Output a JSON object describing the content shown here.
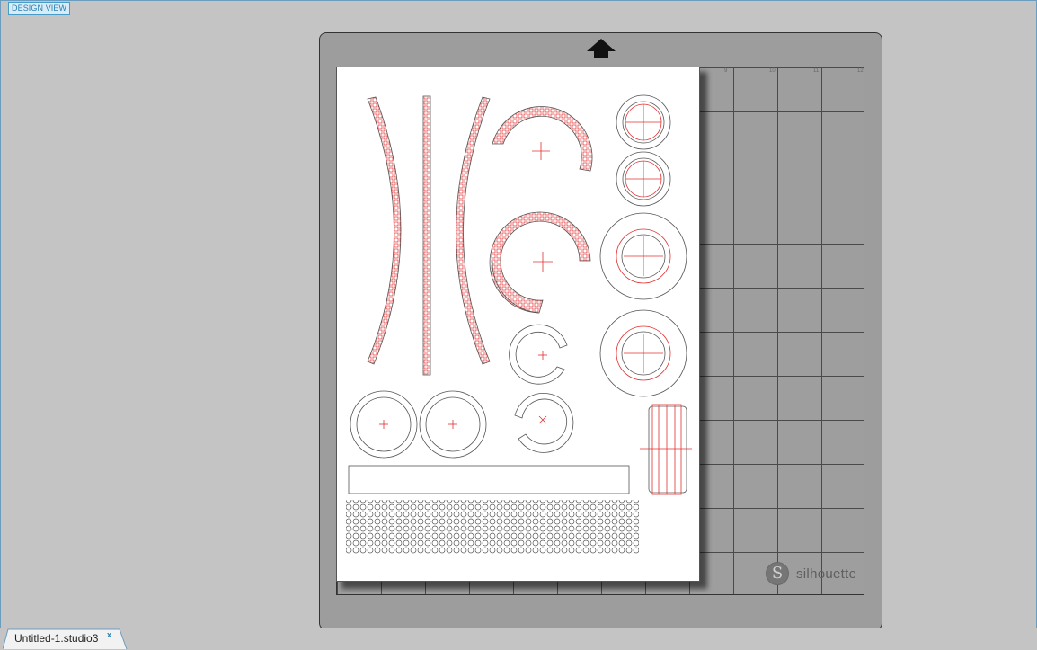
{
  "view": {
    "badge": "DESIGN VIEW"
  },
  "mat": {
    "brand": "silhouette",
    "brand_mark": "S",
    "ruler_top": [
      "9",
      "10",
      "11",
      "12"
    ],
    "feed_icon": "arrow-up-icon"
  },
  "tabs": [
    {
      "label": "Untitled-1.studio3",
      "close": "x"
    }
  ],
  "colors": {
    "background": "#c4c4c4",
    "mat": "#9d9d9d",
    "cut_line": "#555555",
    "registration": "#e03030",
    "accent": "#2a7fb2"
  }
}
